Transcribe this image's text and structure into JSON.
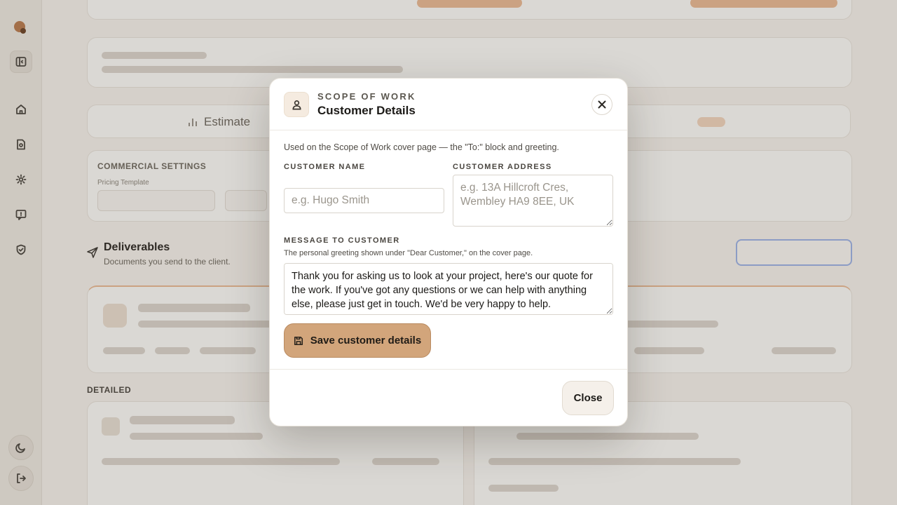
{
  "background": {
    "tabs": {
      "estimate": "Estimate"
    },
    "commercial_settings": {
      "heading": "COMMERCIAL SETTINGS",
      "pricing_template_label": "Pricing Template"
    },
    "deliverables": {
      "title": "Deliverables",
      "subtitle": "Documents you send to the client."
    },
    "detailed_label": "DETAILED"
  },
  "modal": {
    "eyebrow": "SCOPE OF WORK",
    "title": "Customer Details",
    "intro": "Used on the Scope of Work cover page — the \"To:\" block and greeting.",
    "customer_name": {
      "label": "CUSTOMER NAME",
      "value": "",
      "placeholder": "e.g. Hugo Smith"
    },
    "customer_address": {
      "label": "CUSTOMER ADDRESS",
      "value": "",
      "placeholder": "e.g. 13A Hillcroft Cres, Wembley HA9 8EE, UK"
    },
    "message": {
      "label": "MESSAGE TO CUSTOMER",
      "help": "The personal greeting shown under \"Dear Customer,\" on the cover page.",
      "value": "Thank you for asking us to look at your project, here's our quote for the work. If you've got any questions or we can help with anything else, please just get in touch. We'd be very happy to help."
    },
    "save_label": "Save customer details",
    "close_label": "Close"
  },
  "icons": {
    "sidebar": [
      "logo-icon",
      "panel-toggle-icon",
      "home-icon",
      "document-icon",
      "gear-icon",
      "message-icon",
      "shield-check-icon",
      "moon-icon",
      "logout-icon"
    ],
    "modal": [
      "user-icon",
      "close-icon",
      "save-icon"
    ]
  },
  "colors": {
    "accent": "#d2a57b",
    "overlay": "rgba(70,60,48,0.18)",
    "focus_ring": "#9bb1e6"
  }
}
